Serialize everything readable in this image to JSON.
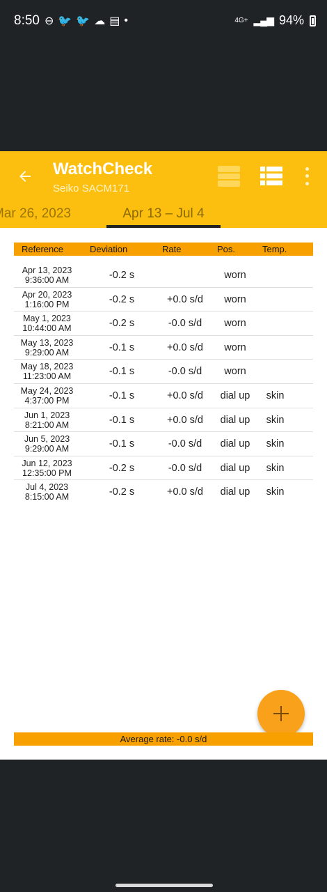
{
  "status_bar": {
    "time": "8:50",
    "battery": "94%",
    "network": "4G+"
  },
  "app_bar": {
    "title": "WatchCheck",
    "subtitle": "Seiko SACM171"
  },
  "tabs": [
    {
      "label": "Mar 26, 2023"
    },
    {
      "label": "Apr 13 – Jul 4"
    }
  ],
  "table": {
    "columns": [
      "Reference",
      "Deviation",
      "Rate",
      "Pos.",
      "Temp."
    ],
    "rows": [
      {
        "date": "Apr 13, 2023",
        "time": "9:36:00 AM",
        "deviation": "-0.2 s",
        "rate": "",
        "pos": "worn",
        "temp": ""
      },
      {
        "date": "Apr 20, 2023",
        "time": "1:16:00 PM",
        "deviation": "-0.2 s",
        "rate": "+0.0 s/d",
        "pos": "worn",
        "temp": ""
      },
      {
        "date": "May 1, 2023",
        "time": "10:44:00 AM",
        "deviation": "-0.2 s",
        "rate": "-0.0 s/d",
        "pos": "worn",
        "temp": ""
      },
      {
        "date": "May 13, 2023",
        "time": "9:29:00 AM",
        "deviation": "-0.1 s",
        "rate": "+0.0 s/d",
        "pos": "worn",
        "temp": ""
      },
      {
        "date": "May 18, 2023",
        "time": "11:23:00 AM",
        "deviation": "-0.1 s",
        "rate": "-0.0 s/d",
        "pos": "worn",
        "temp": ""
      },
      {
        "date": "May 24, 2023",
        "time": "4:37:00 PM",
        "deviation": "-0.1 s",
        "rate": "+0.0 s/d",
        "pos": "dial up",
        "temp": "skin"
      },
      {
        "date": "Jun 1, 2023",
        "time": "8:21:00 AM",
        "deviation": "-0.1 s",
        "rate": "+0.0 s/d",
        "pos": "dial up",
        "temp": "skin"
      },
      {
        "date": "Jun 5, 2023",
        "time": "9:29:00 AM",
        "deviation": "-0.1 s",
        "rate": "-0.0 s/d",
        "pos": "dial up",
        "temp": "skin"
      },
      {
        "date": "Jun 12, 2023",
        "time": "12:35:00 PM",
        "deviation": "-0.2 s",
        "rate": "-0.0 s/d",
        "pos": "dial up",
        "temp": "skin"
      },
      {
        "date": "Jul 4, 2023",
        "time": "8:15:00 AM",
        "deviation": "-0.2 s",
        "rate": "+0.0 s/d",
        "pos": "dial up",
        "temp": "skin"
      }
    ]
  },
  "footer": {
    "average_rate": "Average rate: -0.0 s/d"
  },
  "colors": {
    "accent": "#fdbf0f",
    "header": "#f8a000",
    "fab": "#f9a11b"
  }
}
